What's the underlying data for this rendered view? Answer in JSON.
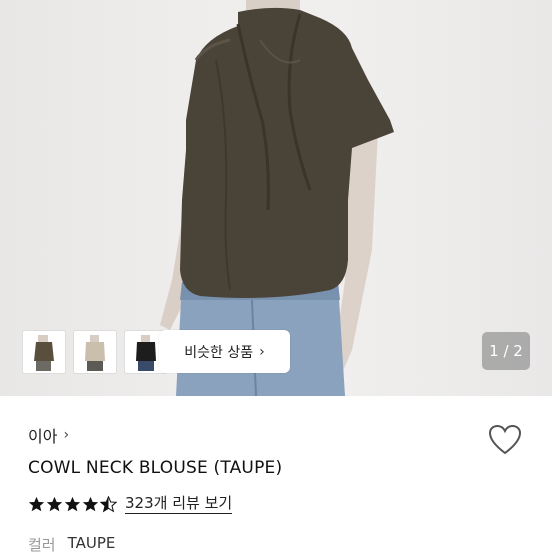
{
  "gallery": {
    "similar_label": "비슷한 상품",
    "similar_chevron": "›",
    "pager": "1 / 2",
    "thumbnails": [
      "thumbnail-1",
      "thumbnail-2",
      "thumbnail-3"
    ]
  },
  "product": {
    "store_name": "이아",
    "store_chevron": "›",
    "title": "COWL NECK BLOUSE (TAUPE)",
    "rating": 4.5,
    "review_link": "323개 리뷰 보기",
    "color_label": "컬러",
    "color_value": "TAUPE"
  },
  "colors": {
    "blouse": "#4a4338",
    "jeans": "#8aa2bd",
    "star": "#111111",
    "pager_bg": "#8c8c8c"
  },
  "icons": [
    "heart-icon",
    "star-icon",
    "chevron-right-icon"
  ]
}
